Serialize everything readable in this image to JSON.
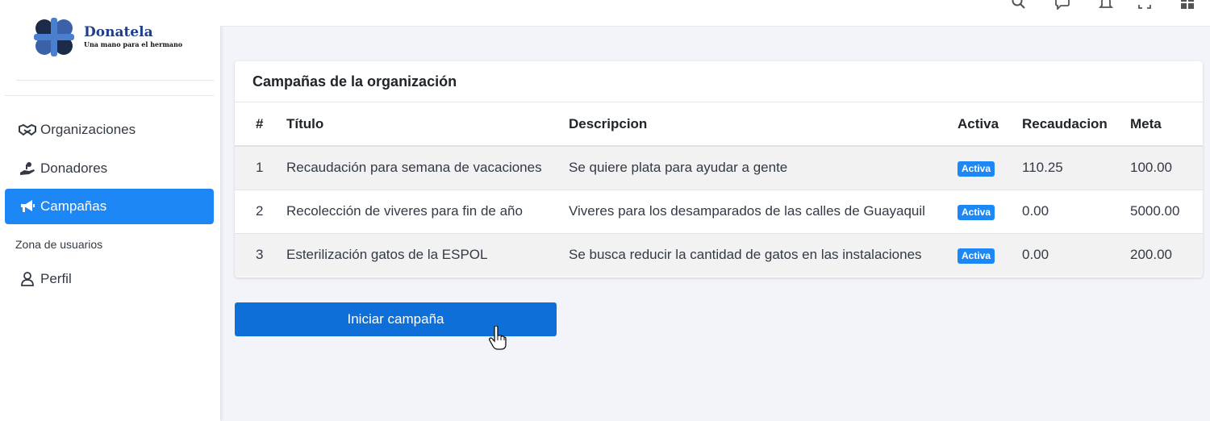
{
  "brand": {
    "name": "Donatela",
    "tagline": "Una mano para el hermano"
  },
  "sidebar": {
    "items": [
      {
        "label": "Organizaciones",
        "icon": "handshake-icon"
      },
      {
        "label": "Donadores",
        "icon": "hand-holding-icon"
      },
      {
        "label": "Campañas",
        "icon": "megaphone-icon",
        "active": true
      }
    ],
    "zone_label": "Zona de usuarios",
    "user_items": [
      {
        "label": "Perfil",
        "icon": "user-icon"
      }
    ]
  },
  "topbar": {
    "icons": [
      "search-icon",
      "chat-icon",
      "bell-icon",
      "fullscreen-icon",
      "apps-grid-icon"
    ]
  },
  "campaigns": {
    "title": "Campañas de la organización",
    "columns": [
      "#",
      "Título",
      "Descripcion",
      "Activa",
      "Recaudacion",
      "Meta"
    ],
    "rows": [
      {
        "num": "1",
        "titulo": "Recaudación para semana de vacaciones",
        "descripcion": "Se quiere plata para ayudar a gente",
        "activa": "Activa",
        "recaudacion": "110.25",
        "meta": "100.00"
      },
      {
        "num": "2",
        "titulo": "Recolección de viveres para fin de año",
        "descripcion": "Viveres para los desamparados de las calles de Guayaquil",
        "activa": "Activa",
        "recaudacion": "0.00",
        "meta": "5000.00"
      },
      {
        "num": "3",
        "titulo": "Esterilización gatos de la ESPOL",
        "descripcion": "Se busca reducir la cantidad de gatos en las instalaciones",
        "activa": "Activa",
        "recaudacion": "0.00",
        "meta": "200.00"
      }
    ]
  },
  "actions": {
    "start_campaign": "Iniciar campaña"
  },
  "colors": {
    "primary": "#1d88f5",
    "button": "#0f6fd8",
    "brand": "#1f3f8a",
    "background": "#f3f4f9"
  }
}
